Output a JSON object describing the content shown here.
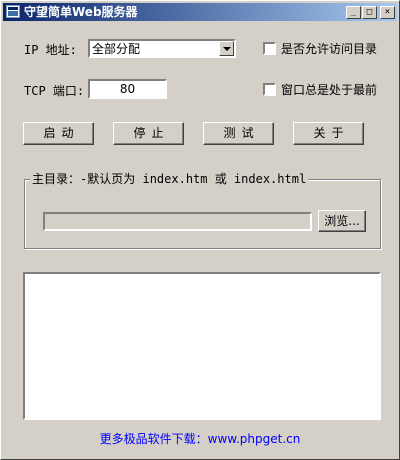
{
  "window": {
    "title": "守望简单Web服务器",
    "controls": {
      "minimize": "_",
      "maximize": "□",
      "close": "×"
    }
  },
  "form": {
    "ip_label": "IP 地址:",
    "ip_value": "全部分配",
    "tcp_label": "TCP 端口:",
    "tcp_value": "80",
    "allow_dir_label": "是否允许访问目录",
    "allow_dir_checked": false,
    "always_top_label": "窗口总是处于最前",
    "always_top_checked": false
  },
  "buttons": {
    "start": "启动",
    "stop": "停止",
    "test": "测试",
    "about": "关于"
  },
  "root_dir": {
    "label": "主目录：",
    "hint": "-默认页为 index.htm 或 index.html",
    "path_value": "",
    "browse_label": "浏览..."
  },
  "log_text": "",
  "footer": {
    "text": "更多极品软件下载：www.phpget.cn",
    "color": "#0000ff"
  }
}
